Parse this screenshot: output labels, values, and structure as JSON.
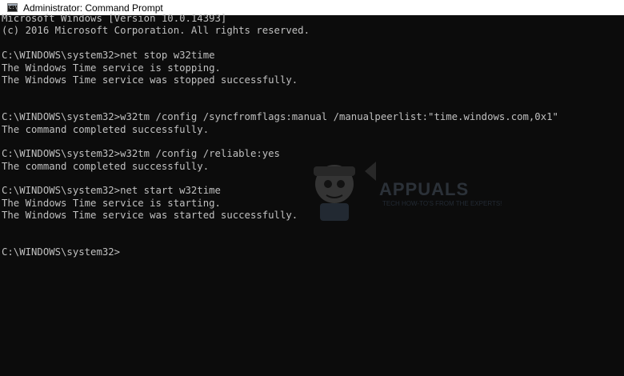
{
  "window": {
    "title": "Administrator: Command Prompt",
    "icon": "command-prompt-icon",
    "icon_glyph": "C:\\"
  },
  "console": {
    "lines": [
      "Microsoft Windows [Version 10.0.14393]",
      "(c) 2016 Microsoft Corporation. All rights reserved.",
      "",
      "C:\\WINDOWS\\system32>net stop w32time",
      "The Windows Time service is stopping.",
      "The Windows Time service was stopped successfully.",
      "",
      "",
      "C:\\WINDOWS\\system32>w32tm /config /syncfromflags:manual /manualpeerlist:\"time.windows.com,0x1\"",
      "The command completed successfully.",
      "",
      "C:\\WINDOWS\\system32>w32tm /config /reliable:yes",
      "The command completed successfully.",
      "",
      "C:\\WINDOWS\\system32>net start w32time",
      "The Windows Time service is starting.",
      "The Windows Time service was started successfully.",
      "",
      "",
      "C:\\WINDOWS\\system32>"
    ]
  },
  "watermark": {
    "brand": "APPUALS",
    "tagline": "TECH HOW-TO'S FROM THE EXPERTS!"
  },
  "colors": {
    "console_background": "#0c0c0c",
    "console_text": "#c0c0c0",
    "titlebar_background": "#ffffff"
  }
}
